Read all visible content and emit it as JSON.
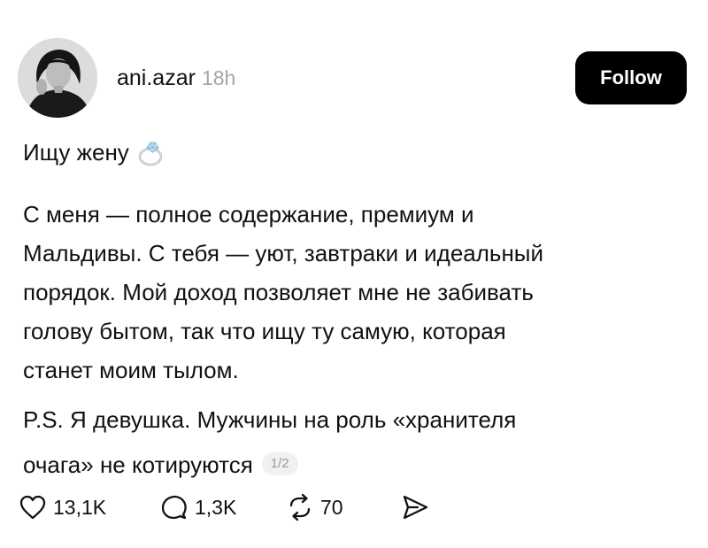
{
  "post": {
    "author": {
      "username": "ani.azar",
      "time_ago": "18h"
    },
    "follow_label": "Follow",
    "title": "Ищу жену",
    "title_emoji": "ring-icon",
    "body_lines": [
      "С меня — полное содержание, премиум и",
      "Мальдивы. С тебя — уют, завтраки и идеальный",
      "порядок. Мой доход позволяет мне не забивать",
      "голову бытом, так что ищу ту самую, которая",
      "станет моим тылом."
    ],
    "ps_lines": [
      "P.S. Я девушка. Мужчины на роль «хранителя",
      "очага» не котируются"
    ],
    "page_indicator": "1/2",
    "actions": {
      "likes": "13,1K",
      "comments": "1,3K",
      "reposts": "70"
    },
    "icons": {
      "like": "heart-icon",
      "comment": "comment-bubble-icon",
      "repost": "repost-icon",
      "share": "send-icon"
    },
    "colors": {
      "follow_bg": "#000000",
      "follow_text": "#ffffff",
      "muted_text": "#a6a6a6",
      "text": "#111111"
    }
  }
}
